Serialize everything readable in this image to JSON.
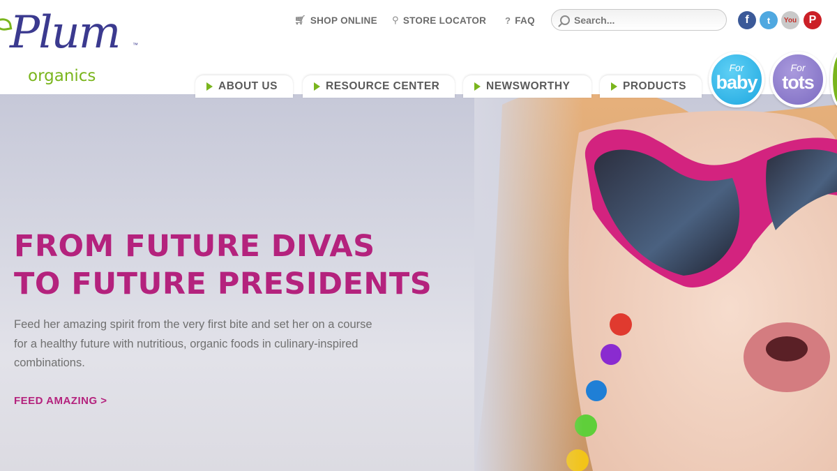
{
  "brand": {
    "name": "Plum",
    "tm": "™",
    "sub": "organics"
  },
  "utility_nav": {
    "shop_online": "SHOP ONLINE",
    "store_locator": "STORE LOCATOR",
    "faq": "FAQ"
  },
  "search": {
    "placeholder": "Search..."
  },
  "social": [
    {
      "name": "facebook-icon",
      "glyph": "f",
      "color": "#3b5998"
    },
    {
      "name": "twitter-icon",
      "glyph": "t",
      "color": "#4fa8e0"
    },
    {
      "name": "youtube-icon",
      "glyph": "You",
      "color": "#c4302b"
    },
    {
      "name": "pinterest-icon",
      "glyph": "P",
      "color": "#cb2027"
    }
  ],
  "main_nav": [
    "ABOUT US",
    "RESOURCE CENTER",
    "NEWSWORTHY",
    "PRODUCTS"
  ],
  "audience": {
    "baby": {
      "for": "For",
      "word": "baby"
    },
    "tots": {
      "for": "For",
      "word": "tots"
    }
  },
  "hero": {
    "headline_line1": "FROM FUTURE DIVAS",
    "headline_line2": "TO FUTURE PRESIDENTS",
    "body": "Feed her amazing spirit from the very first bite and set her on a course for a healthy future with nutritious, organic foods in culinary-inspired combinations.",
    "cta": "FEED AMAZING >"
  },
  "colors": {
    "brand_purple": "#3b3a8f",
    "brand_green": "#7ab51d",
    "headline_magenta": "#b4227d",
    "baby_blue": "#1ea7e0",
    "tots_purple": "#7c6bc1"
  }
}
